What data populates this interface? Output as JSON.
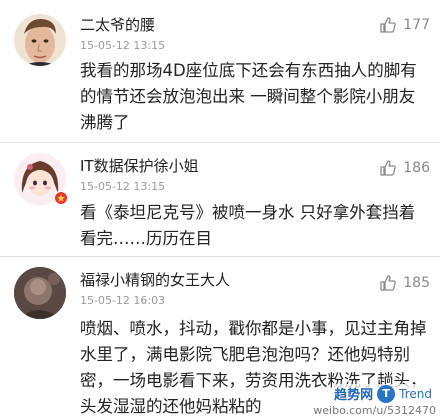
{
  "comments": [
    {
      "user": "二太爷的腰",
      "time": "15-05-12 13:15",
      "likes": "177",
      "text": "我看的那场4D座位底下还会有东西抽人的脚有的情节还会放泡泡出来 一瞬间整个影院小朋友沸腾了",
      "avatar_icon": "man-face-avatar"
    },
    {
      "user": "IT数据保护徐小姐",
      "time": "15-05-12 13:15",
      "likes": "186",
      "text": "看《泰坦尼克号》被喷一身水 只好拿外套挡着看完……历历在目",
      "avatar_icon": "cartoon-girl-avatar"
    },
    {
      "user": "福禄小精钢的女王大人",
      "time": "15-05-12 16:03",
      "likes": "185",
      "text": "喷烟、喷水，抖动，戳你都是小事，见过主角掉水里了，满电影院飞肥皂泡泡吗？还他妈特别密，一场电影看下来，劳资用洗衣粉洗了趟头，头发湿湿的还他妈粘粘的",
      "avatar_icon": "dark-photo-avatar"
    }
  ],
  "watermark": {
    "brand": "趋势网",
    "logo": "T",
    "site": "Trend",
    "handle": "weibo.com/u/5312470"
  },
  "colors": {
    "time": "#9a9a9a",
    "like": "#8a8a8a",
    "separator": "#e3e3e3",
    "watermark": "#2d6fb5"
  }
}
